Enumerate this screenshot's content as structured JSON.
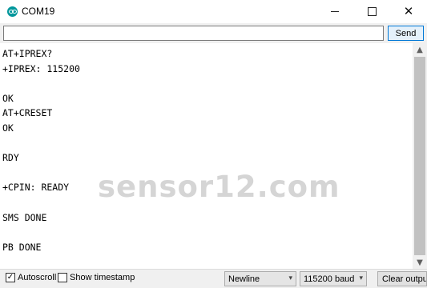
{
  "window": {
    "title": "COM19",
    "app_icon": "arduino-icon",
    "minimize_icon": "minimize-icon",
    "maximize_icon": "maximize-icon",
    "close_icon": "close-icon"
  },
  "send_bar": {
    "input_value": "",
    "send_label": "Send"
  },
  "serial_output": {
    "lines": [
      "AT+IPREX?",
      "+IPREX: 115200",
      "",
      "OK",
      "AT+CRESET",
      "OK",
      "",
      "RDY",
      "",
      "+CPIN: READY",
      "",
      "SMS DONE",
      "",
      "PB DONE"
    ],
    "watermark": "sensor12.com"
  },
  "scrollbar": {
    "up_icon": "scroll-up-arrow-icon",
    "down_icon": "scroll-down-arrow-icon"
  },
  "bottom_bar": {
    "autoscroll_label": "Autoscroll",
    "autoscroll_checked": true,
    "timestamp_label": "Show timestamp",
    "timestamp_checked": false,
    "line_ending_selected": "Newline",
    "baud_selected": "115200 baud",
    "clear_label": "Clear output"
  },
  "colors": {
    "accent": "#00979c",
    "send_border": "#0078d7",
    "chrome_bg": "#f0f0f0"
  }
}
